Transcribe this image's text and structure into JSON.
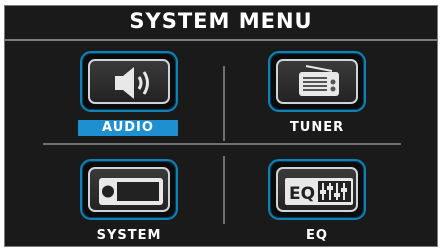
{
  "title": "SYSTEM MENU",
  "items": [
    {
      "label": "AUDIO",
      "icon": "speaker-icon",
      "selected": true
    },
    {
      "label": "TUNER",
      "icon": "radio-icon",
      "selected": false
    },
    {
      "label": "SYSTEM",
      "icon": "device-icon",
      "selected": false
    },
    {
      "label": "EQ",
      "icon": "equalizer-icon",
      "selected": false,
      "icon_text": "EQ"
    }
  ],
  "colors": {
    "accent": "#1e8fd0",
    "tile_border": "#0e82b6",
    "background": "#1a1a1a"
  }
}
